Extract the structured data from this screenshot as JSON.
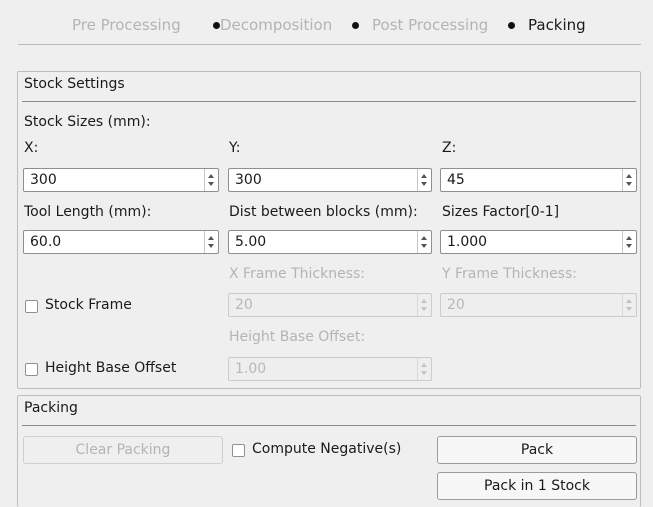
{
  "steps": [
    {
      "label": "Pre Processing",
      "active": false
    },
    {
      "label": "Decomposition",
      "active": false
    },
    {
      "label": "Post Processing",
      "active": false
    },
    {
      "label": "Packing",
      "active": true
    }
  ],
  "stock_settings": {
    "title": "Stock Settings",
    "stock_sizes_label": "Stock Sizes (mm):",
    "x_label": "X:",
    "y_label": "Y:",
    "z_label": "Z:",
    "x_value": "300",
    "y_value": "300",
    "z_value": "45",
    "tool_length_label": "Tool Length (mm):",
    "tool_length_value": "60.0",
    "dist_blocks_label": "Dist between blocks (mm):",
    "dist_blocks_value": "5.00",
    "sizes_factor_label": "Sizes Factor[0-1]",
    "sizes_factor_value": "1.000",
    "x_frame_label": "X Frame Thickness:",
    "y_frame_label": "Y Frame Thickness:",
    "x_frame_value": "20",
    "y_frame_value": "20",
    "stock_frame_label": "Stock Frame",
    "stock_frame_checked": false,
    "height_base_offset_label": "Height Base Offset:",
    "height_base_offset_value": "1.00",
    "height_base_offset_check_label": "Height Base Offset",
    "height_base_offset_checked": false
  },
  "packing": {
    "title": "Packing",
    "clear_label": "Clear Packing",
    "compute_negative_label": "Compute Negative(s)",
    "compute_negative_checked": false,
    "pack_label": "Pack",
    "pack_one_stock_label": "Pack in 1 Stock"
  }
}
